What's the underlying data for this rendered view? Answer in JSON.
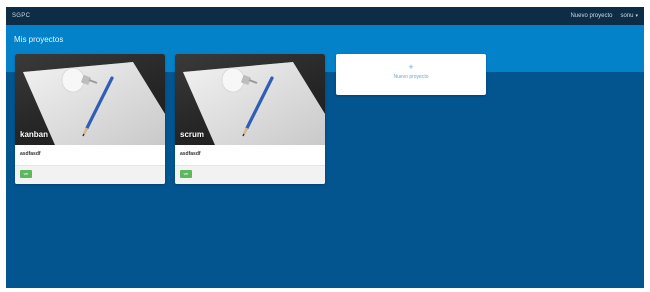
{
  "navbar": {
    "brand": "SGPC",
    "new_project_link": "Nuevo proyecto",
    "user_menu": "sonu"
  },
  "page": {
    "title": "Mis proyectos"
  },
  "projects": [
    {
      "name": "kanban",
      "description": "asdfasdf",
      "view_label": "ver"
    },
    {
      "name": "scrum",
      "description": "asdfasdf",
      "view_label": "ver"
    }
  ],
  "new_project_card": {
    "plus": "+",
    "label": "Nuevo proyecto"
  },
  "colors": {
    "navbar": "#0d2d47",
    "header_band": "#0381c9",
    "background": "#03558f",
    "button_green": "#5cb85c"
  }
}
